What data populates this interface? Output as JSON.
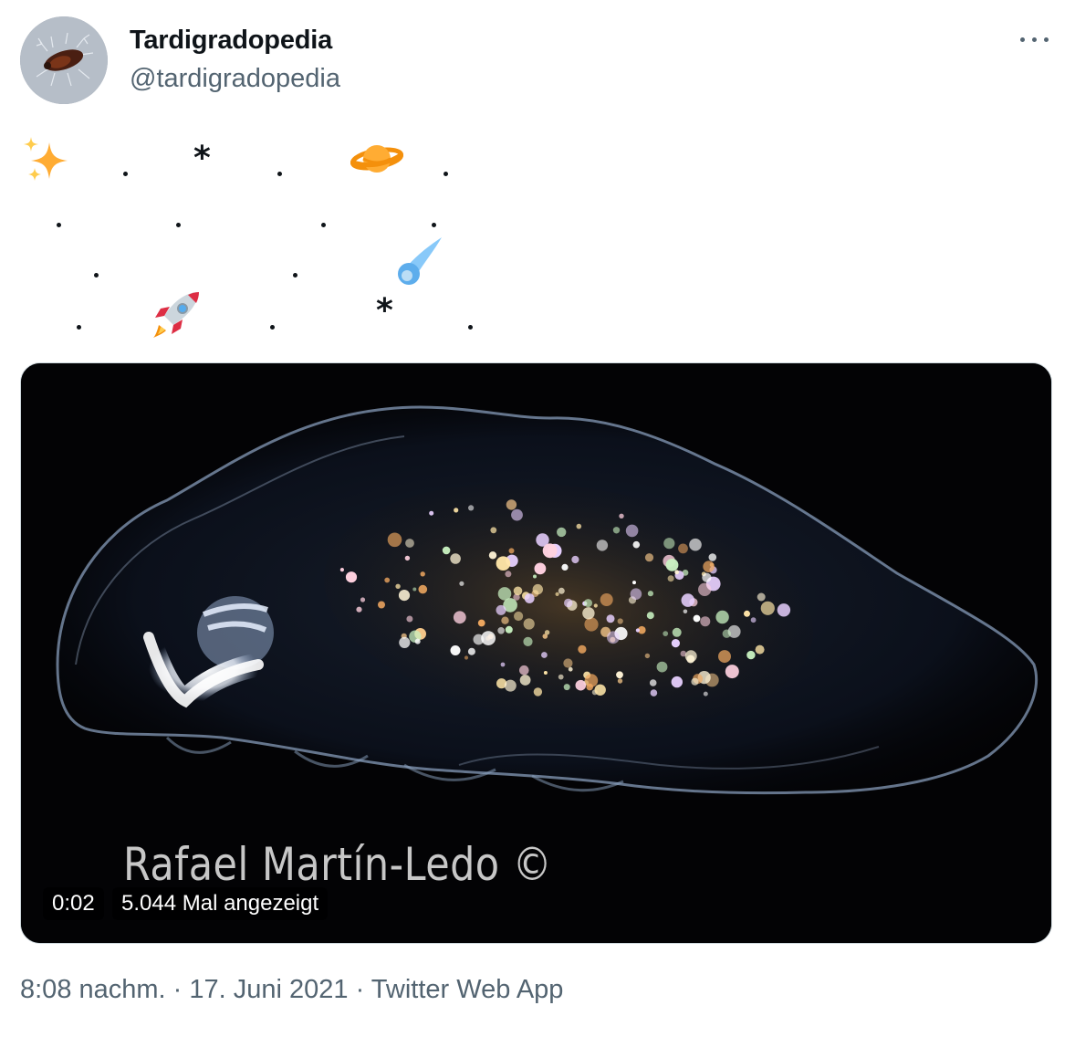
{
  "author": {
    "display_name": "Tardigradopedia",
    "handle": "@tardigradopedia",
    "avatar_icon": "tardigrade-avatar"
  },
  "menu": {
    "more_icon": "more-horizontal-icon"
  },
  "tweet": {
    "emojis": {
      "sparkles": "sparkles-emoji",
      "planet": "ringed-planet-emoji",
      "comet": "comet-emoji",
      "rocket": "rocket-emoji"
    },
    "stars": [
      "*",
      "*"
    ]
  },
  "media": {
    "type": "video",
    "watermark": "Rafael Martín-Ledo ©",
    "duration": "0:02",
    "views": "5.044 Mal angezeigt"
  },
  "footer": {
    "time": "8:08 nachm.",
    "separator": " · ",
    "date": "17. Juni 2021",
    "source": "Twitter Web App"
  }
}
